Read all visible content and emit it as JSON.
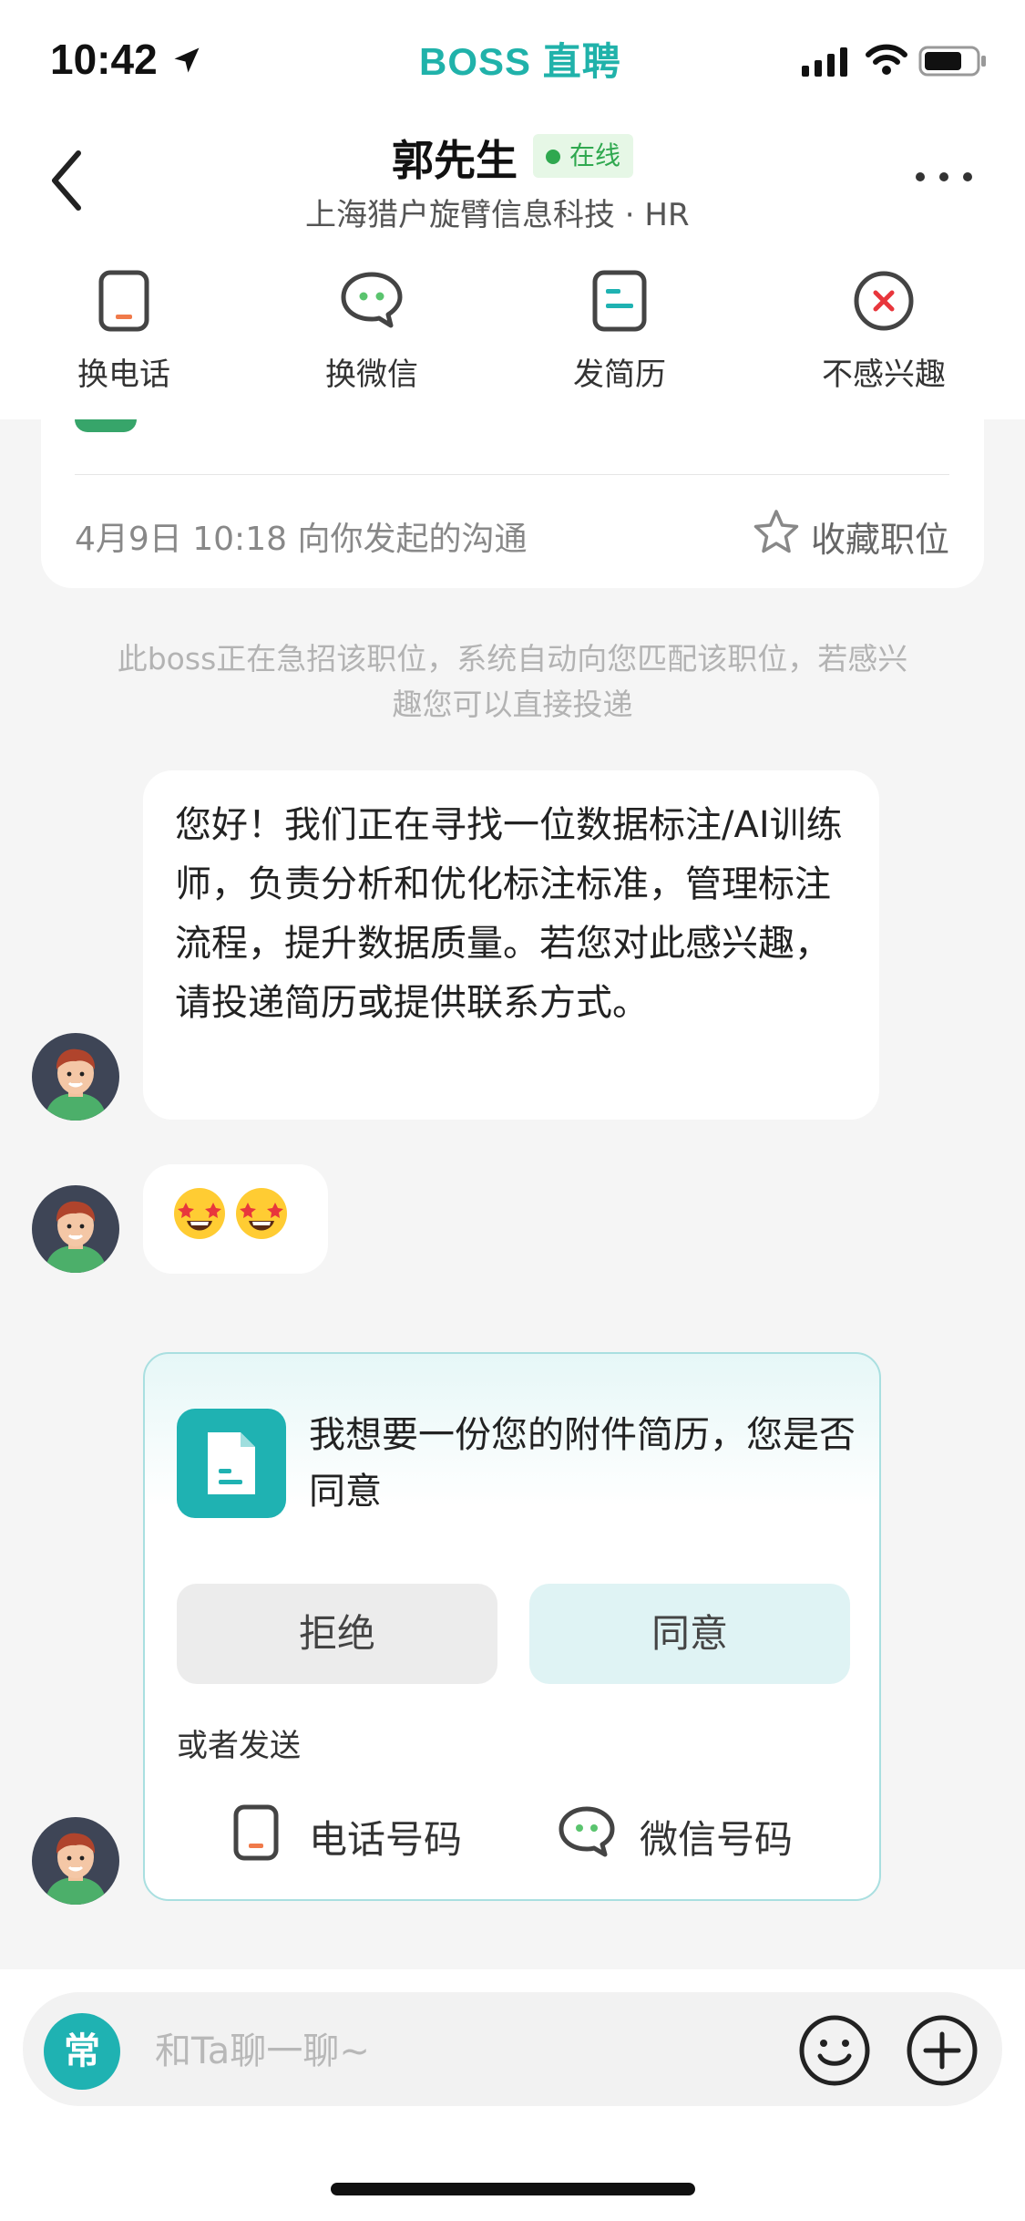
{
  "status_bar": {
    "time": "10:42",
    "brand": "BOSS 直聘"
  },
  "header": {
    "contact_name": "郭先生",
    "online_status": "在线",
    "company_role": "上海猎户旋臂信息科技 · HR",
    "actions": [
      {
        "label": "换电话",
        "icon": "phone-icon"
      },
      {
        "label": "换微信",
        "icon": "wechat-icon"
      },
      {
        "label": "发简历",
        "icon": "resume-icon"
      },
      {
        "label": "不感兴趣",
        "icon": "not-interested-icon"
      }
    ]
  },
  "job_card": {
    "initiated_text": "4月9日 10:18 向你发起的沟通",
    "favorite_label": "收藏职位"
  },
  "system_note": "此boss正在急招该职位，系统自动向您匹配该职位，若感兴趣您可以直接投递",
  "messages": {
    "greeting": "您好！我们正在寻找一位数据标注/AI训练师，负责分析和优化标注标准，管理标注流程，提升数据质量。若您对此感兴趣，请投递简历或提供联系方式。",
    "emoji": "🤩🤩"
  },
  "resume_request": {
    "text": "我想要一份您的附件简历，您是否同意",
    "reject_label": "拒绝",
    "agree_label": "同意",
    "or_send": "或者发送",
    "phone_label": "电话号码",
    "wechat_label": "微信号码"
  },
  "input_bar": {
    "common_label": "常",
    "placeholder": "和Ta聊一聊~"
  },
  "colors": {
    "brand": "#20b2aa",
    "online": "#2fa84f",
    "phone_accent": "#f07a4a",
    "wechat_accent": "#5ac46e",
    "not_interested": "#e8363c"
  }
}
